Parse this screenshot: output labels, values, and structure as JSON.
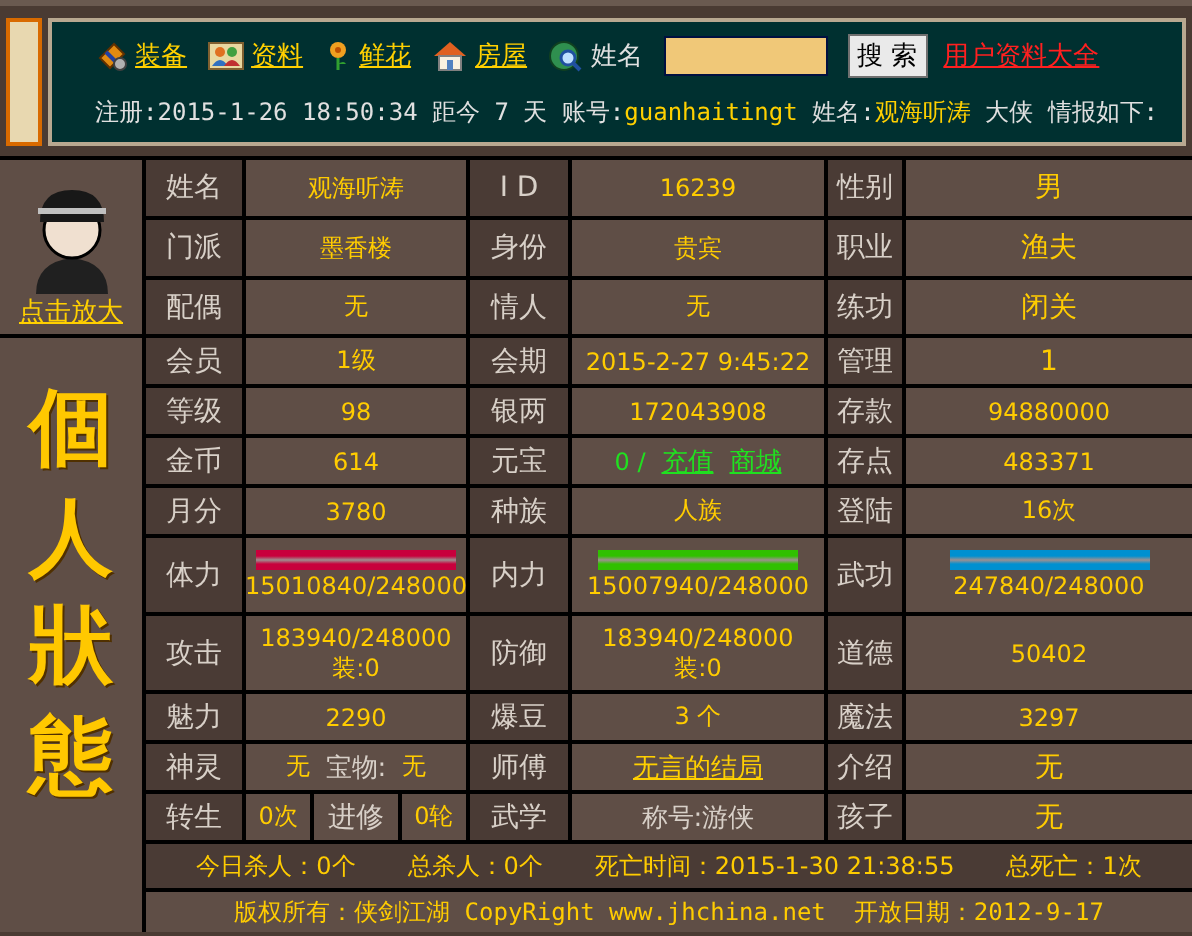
{
  "header": {
    "nav": [
      {
        "label": "装备"
      },
      {
        "label": "资料"
      },
      {
        "label": "鲜花"
      },
      {
        "label": "房屋"
      }
    ],
    "search": {
      "label": "姓名",
      "button": "搜 索"
    },
    "link": "用户资料大全",
    "info": [
      {
        "kind": "plain",
        "text": "注册:2015-1-26 18:50:34 距今 7 天 账号:"
      },
      {
        "kind": "highlight",
        "text": "guanhaitingt"
      },
      {
        "kind": "plain",
        "text": " 姓名:"
      },
      {
        "kind": "highlight",
        "text": "观海听涛"
      },
      {
        "kind": "plain",
        "text": " 大侠 情报如下:"
      }
    ]
  },
  "sidebar": {
    "enlarge_link": "点击放大",
    "title": "個人狀態"
  },
  "rows": [
    {
      "cells": [
        {
          "kind": "label",
          "text": "姓名"
        },
        {
          "kind": "value",
          "text": "观海听涛"
        },
        {
          "kind": "label",
          "text": "I D"
        },
        {
          "kind": "value",
          "text": "16239"
        },
        {
          "kind": "label",
          "text": "性别"
        },
        {
          "kind": "value",
          "text": "男"
        }
      ]
    },
    {
      "cells": [
        {
          "kind": "label",
          "text": "门派"
        },
        {
          "kind": "value",
          "text": "墨香楼"
        },
        {
          "kind": "label",
          "text": "身份"
        },
        {
          "kind": "value",
          "text": "贵宾"
        },
        {
          "kind": "label",
          "text": "职业"
        },
        {
          "kind": "value",
          "text": "渔夫"
        }
      ]
    },
    {
      "cells": [
        {
          "kind": "label",
          "text": "配偶"
        },
        {
          "kind": "value",
          "text": "无"
        },
        {
          "kind": "label",
          "text": "情人"
        },
        {
          "kind": "value",
          "text": "无"
        },
        {
          "kind": "label",
          "text": "练功"
        },
        {
          "kind": "value",
          "text": "闭关"
        }
      ]
    },
    {
      "cells": [
        {
          "kind": "label",
          "text": "会员"
        },
        {
          "kind": "value",
          "text": "1级"
        },
        {
          "kind": "label",
          "text": "会期"
        },
        {
          "kind": "value",
          "text": "2015-2-27 9:45:22"
        },
        {
          "kind": "label",
          "text": "管理"
        },
        {
          "kind": "value",
          "text": "1"
        }
      ]
    },
    {
      "cells": [
        {
          "kind": "label",
          "text": "等级"
        },
        {
          "kind": "value",
          "text": "98"
        },
        {
          "kind": "label",
          "text": "银两"
        },
        {
          "kind": "value",
          "text": "172043908"
        },
        {
          "kind": "label",
          "text": "存款"
        },
        {
          "kind": "value",
          "text": "94880000"
        }
      ]
    },
    {
      "cells": [
        {
          "kind": "label",
          "text": "金币"
        },
        {
          "kind": "value",
          "text": "614"
        },
        {
          "kind": "label",
          "text": "元宝"
        },
        {
          "kind": "mixed",
          "parts": [
            {
              "kind": "stat",
              "text": "0 /"
            },
            {
              "kind": "stat-link",
              "text": "充值"
            },
            {
              "kind": "stat-link",
              "text": "商城"
            }
          ]
        },
        {
          "kind": "label",
          "text": "存点"
        },
        {
          "kind": "value",
          "text": "483371"
        }
      ]
    },
    {
      "cells": [
        {
          "kind": "label",
          "text": "月分"
        },
        {
          "kind": "value",
          "text": "3780"
        },
        {
          "kind": "label",
          "text": "种族"
        },
        {
          "kind": "value",
          "text": "人族"
        },
        {
          "kind": "label",
          "text": "登陆"
        },
        {
          "kind": "value",
          "text": "16次"
        }
      ]
    },
    {
      "cells": [
        {
          "kind": "label",
          "text": "体力"
        },
        {
          "kind": "bar",
          "level": 1,
          "color": "#c8003c",
          "reading": "15010840/248000"
        },
        {
          "kind": "label",
          "text": "内力"
        },
        {
          "kind": "bar",
          "level": 1,
          "color": "#30c000",
          "reading": "15007940/248000"
        },
        {
          "kind": "label",
          "text": "武功"
        },
        {
          "kind": "bar",
          "level": 1,
          "color": "#0090d0",
          "reading": "247840/248000"
        }
      ]
    },
    {
      "cells": [
        {
          "kind": "label",
          "text": "攻击"
        },
        {
          "kind": "lines",
          "lines": [
            "183940/248000",
            "装:0"
          ]
        },
        {
          "kind": "label",
          "text": "防御"
        },
        {
          "kind": "lines",
          "lines": [
            "183940/248000",
            "装:0"
          ]
        },
        {
          "kind": "label",
          "text": "道德"
        },
        {
          "kind": "value",
          "text": "50402"
        }
      ]
    },
    {
      "cells": [
        {
          "kind": "label",
          "text": "魅力"
        },
        {
          "kind": "value",
          "text": "2290"
        },
        {
          "kind": "label",
          "text": "爆豆"
        },
        {
          "kind": "value",
          "text": "3 个"
        },
        {
          "kind": "label",
          "text": "魔法"
        },
        {
          "kind": "value",
          "text": "3297"
        }
      ]
    },
    {
      "cells": [
        {
          "kind": "label",
          "text": "神灵"
        },
        {
          "kind": "mixed",
          "parts": [
            {
              "kind": "value",
              "text": "无"
            },
            {
              "kind": "label",
              "text": "宝物:"
            },
            {
              "kind": "value",
              "text": "无"
            }
          ]
        },
        {
          "kind": "label",
          "text": "师傅"
        },
        {
          "kind": "link",
          "text": "无言的结局"
        },
        {
          "kind": "label",
          "text": "介绍"
        },
        {
          "kind": "value",
          "text": "无"
        }
      ]
    },
    {
      "cells": [
        {
          "kind": "label",
          "text": "转生"
        },
        {
          "kind": "split",
          "parts": [
            {
              "kind": "value",
              "text": "0次"
            },
            {
              "kind": "label",
              "text": "进修"
            },
            {
              "kind": "value",
              "text": "0轮"
            }
          ]
        },
        {
          "kind": "label",
          "text": "武学"
        },
        {
          "kind": "muted",
          "text": "称号:游侠"
        },
        {
          "kind": "label",
          "text": "孩子"
        },
        {
          "kind": "value",
          "text": "无"
        }
      ]
    }
  ],
  "summary": [
    "今日杀人：0个",
    "总杀人：0个",
    "死亡时间：2015-1-30 21:38:55",
    "总死亡：1次"
  ],
  "footer": [
    "版权所有：侠剑江湖 CopyRight www.jhchina.net",
    "开放日期：2012-9-17"
  ]
}
